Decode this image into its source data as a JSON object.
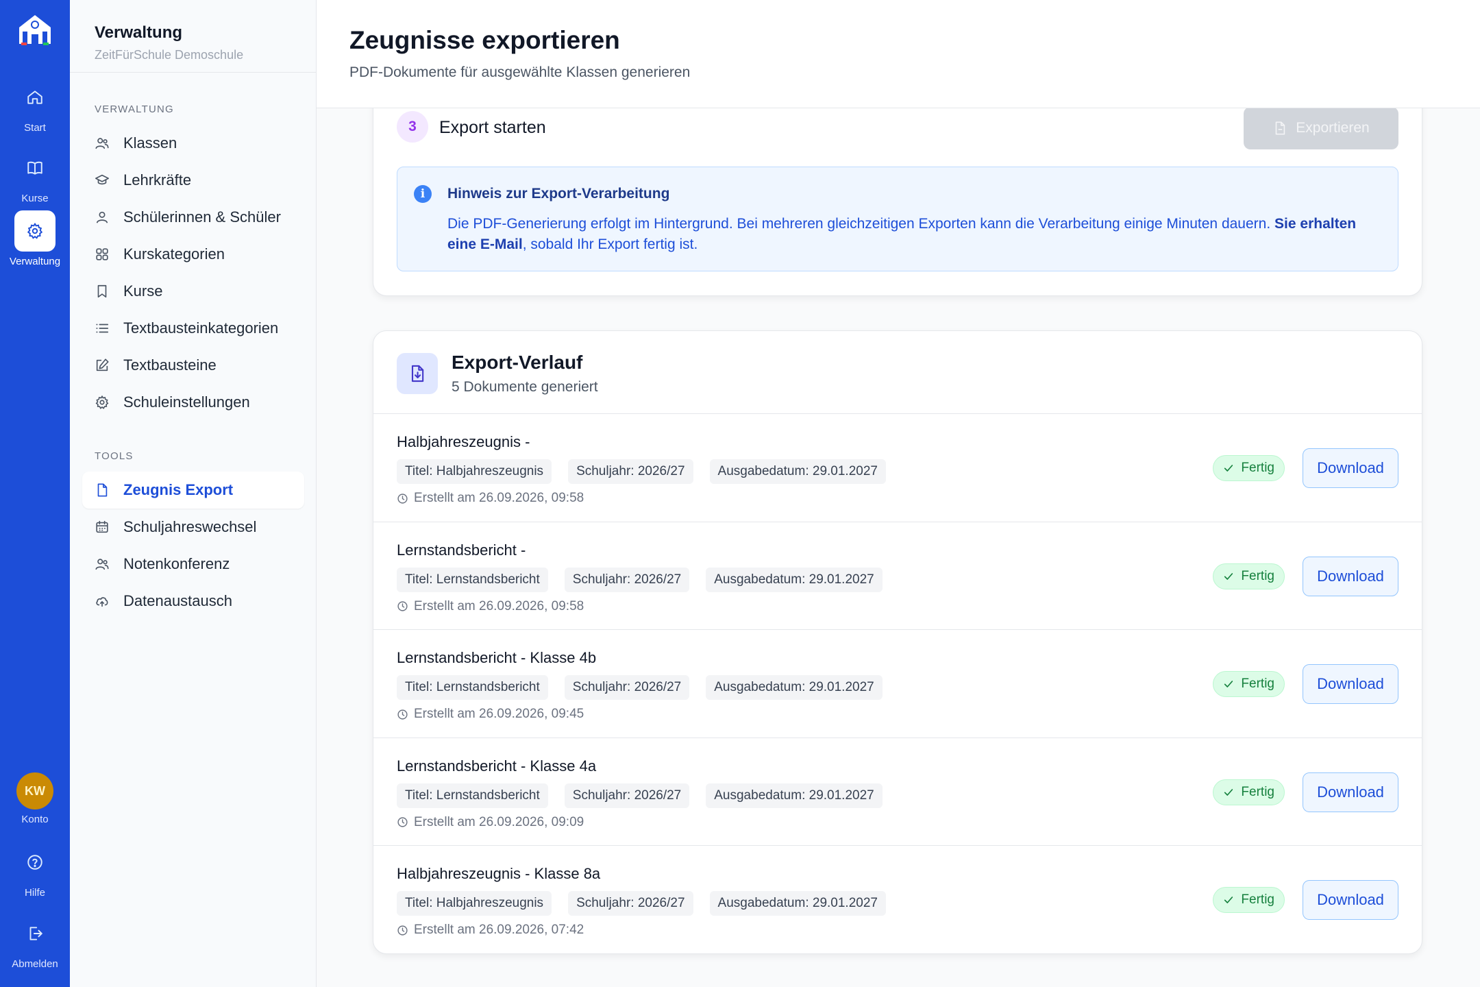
{
  "rail": {
    "logo_icon": "school-logo-icon",
    "items": [
      {
        "label": "Start",
        "icon": "home-icon"
      },
      {
        "label": "Kurse",
        "icon": "book-icon"
      },
      {
        "label": "Verwaltung",
        "icon": "gear-icon"
      }
    ],
    "account": {
      "initials": "KW",
      "label": "Konto"
    },
    "help_label": "Hilfe",
    "logout_label": "Abmelden"
  },
  "sidebar": {
    "title": "Verwaltung",
    "subtitle": "ZeitFürSchule Demoschule",
    "section_admin": "VERWALTUNG",
    "admin_items": [
      {
        "label": "Klassen",
        "icon": "users-icon"
      },
      {
        "label": "Lehrkräfte",
        "icon": "graduation-cap-icon"
      },
      {
        "label": "Schülerinnen & Schüler",
        "icon": "user-icon"
      },
      {
        "label": "Kurskategorien",
        "icon": "grid-icon"
      },
      {
        "label": "Kurse",
        "icon": "bookmark-icon"
      },
      {
        "label": "Textbausteinkategorien",
        "icon": "list-icon"
      },
      {
        "label": "Textbausteine",
        "icon": "edit-icon"
      },
      {
        "label": "Schuleinstellungen",
        "icon": "gear-icon"
      }
    ],
    "section_tools": "TOOLS",
    "tool_items": [
      {
        "label": "Zeugnis Export",
        "icon": "file-icon",
        "active": true
      },
      {
        "label": "Schuljahreswechsel",
        "icon": "calendar-icon"
      },
      {
        "label": "Notenkonferenz",
        "icon": "users-icon"
      },
      {
        "label": "Datenaustausch",
        "icon": "cloud-upload-icon"
      }
    ]
  },
  "header": {
    "title": "Zeugnisse exportieren",
    "subtitle": "PDF-Dokumente für ausgewählte Klassen generieren"
  },
  "export_step": {
    "number": "3",
    "title": "Export starten",
    "button_label": "Exportieren",
    "notice_title": "Hinweis zur Export-Verarbeitung",
    "notice_text": "Die PDF-Generierung erfolgt im Hintergrund. Bei mehreren gleichzeitigen Exporten kann die Verarbeitung einige Minuten dauern.",
    "notice_bold": "Sie erhalten eine E-Mail",
    "notice_tail": ", sobald Ihr Export fertig ist."
  },
  "history": {
    "title": "Export-Verlauf",
    "subtitle": "5 Dokumente generiert",
    "download_label": "Download",
    "items": [
      {
        "name": "Halbjahreszeugnis -",
        "titel": "Titel: Halbjahreszeugnis",
        "schuljahr": "Schuljahr: 2026/27",
        "ausgabe": "Ausgabedatum: 29.01.2027",
        "created": "Erstellt am 26.09.2026, 09:58",
        "status": "Fertig"
      },
      {
        "name": "Lernstandsbericht -",
        "titel": "Titel: Lernstandsbericht",
        "schuljahr": "Schuljahr: 2026/27",
        "ausgabe": "Ausgabedatum: 29.01.2027",
        "created": "Erstellt am 26.09.2026, 09:58",
        "status": "Fertig"
      },
      {
        "name": "Lernstandsbericht - Klasse 4b",
        "titel": "Titel: Lernstandsbericht",
        "schuljahr": "Schuljahr: 2026/27",
        "ausgabe": "Ausgabedatum: 29.01.2027",
        "created": "Erstellt am 26.09.2026, 09:45",
        "status": "Fertig"
      },
      {
        "name": "Lernstandsbericht - Klasse 4a",
        "titel": "Titel: Lernstandsbericht",
        "schuljahr": "Schuljahr: 2026/27",
        "ausgabe": "Ausgabedatum: 29.01.2027",
        "created": "Erstellt am 26.09.2026, 09:09",
        "status": "Fertig"
      },
      {
        "name": "Halbjahreszeugnis - Klasse 8a",
        "titel": "Titel: Halbjahreszeugnis",
        "schuljahr": "Schuljahr: 2026/27",
        "ausgabe": "Ausgabedatum: 29.01.2027",
        "created": "Erstellt am 26.09.2026, 07:42",
        "status": "Fertig"
      }
    ]
  },
  "colors": {
    "brand": "#1d4ed8",
    "status_ok": "#15803d",
    "step_accent": "#9333ea"
  }
}
